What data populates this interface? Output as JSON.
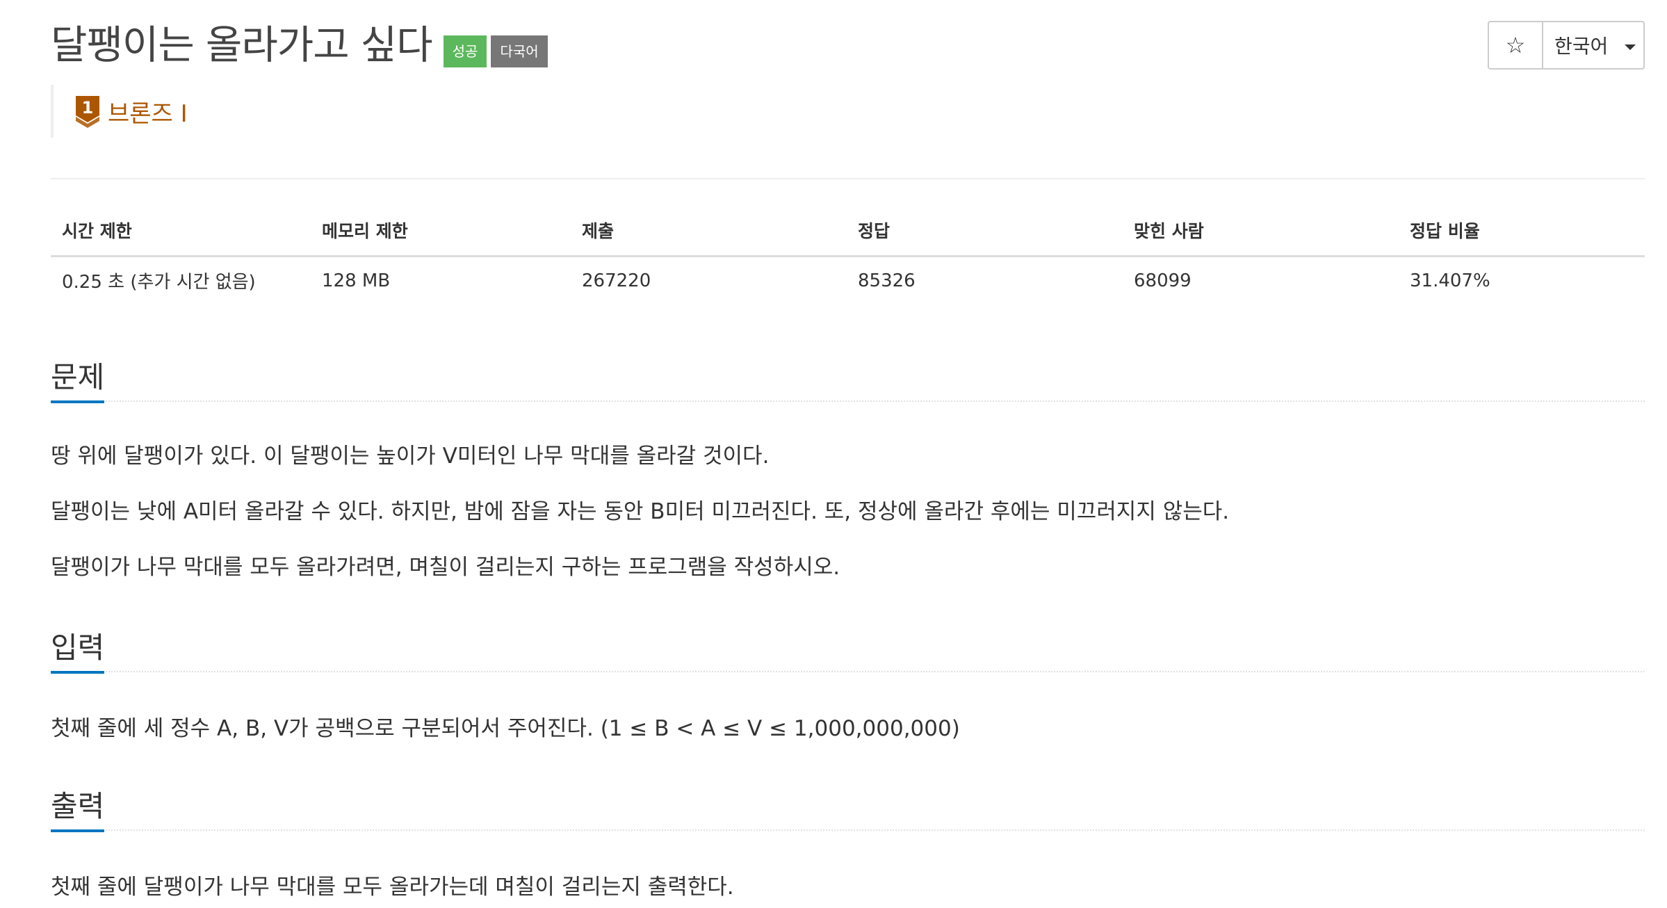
{
  "problem": {
    "title": "달팽이는 올라가고 싶다",
    "labels": {
      "success": "성공",
      "multilang": "다국어"
    },
    "tier": {
      "icon": "bronze-tier-icon",
      "number": "1",
      "name": "브론즈 I",
      "color": "#ad5600"
    }
  },
  "controls": {
    "star_icon": "☆",
    "language": "한국어"
  },
  "info_table": {
    "headers": [
      "시간 제한",
      "메모리 제한",
      "제출",
      "정답",
      "맞힌 사람",
      "정답 비율"
    ],
    "row": [
      "0.25 초 (추가 시간 없음)",
      "128 MB",
      "267220",
      "85326",
      "68099",
      "31.407%"
    ]
  },
  "sections": {
    "problem": {
      "title": "문제",
      "paragraphs": [
        "땅 위에 달팽이가 있다. 이 달팽이는 높이가 V미터인 나무 막대를 올라갈 것이다.",
        "달팽이는 낮에 A미터 올라갈 수 있다. 하지만, 밤에 잠을 자는 동안 B미터 미끄러진다. 또, 정상에 올라간 후에는 미끄러지지 않는다.",
        "달팽이가 나무 막대를 모두 올라가려면, 며칠이 걸리는지 구하는 프로그램을 작성하시오."
      ]
    },
    "input": {
      "title": "입력",
      "paragraphs": [
        "첫째 줄에 세 정수 A, B, V가 공백으로 구분되어서 주어진다. (1 ≤ B < A ≤ V ≤ 1,000,000,000)"
      ]
    },
    "output": {
      "title": "출력",
      "paragraphs": [
        "첫째 줄에 달팽이가 나무 막대를 모두 올라가는데 며칠이 걸리는지 출력한다."
      ]
    }
  },
  "colors": {
    "success_label": "#5cb85c",
    "multilang_label": "#777777",
    "section_underline": "#0076c0",
    "tier_bronze": "#ad5600"
  }
}
